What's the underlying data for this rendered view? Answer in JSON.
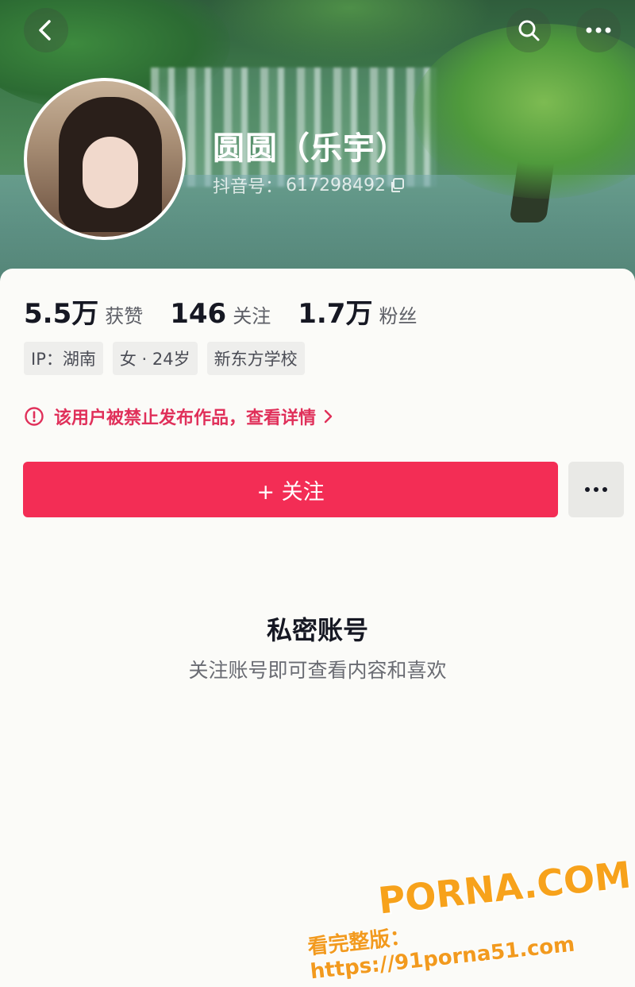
{
  "header": {
    "back_icon": "chevron-left-icon",
    "search_icon": "search-icon",
    "more_icon": "more-horizontal-icon"
  },
  "profile": {
    "name": "圆圆（乐宇）",
    "id_label": "抖音号：",
    "id_value": "617298492",
    "copy_icon": "copy-icon"
  },
  "stats": [
    {
      "value": "5.5万",
      "label": "获赞"
    },
    {
      "value": "146",
      "label": "关注"
    },
    {
      "value": "1.7万",
      "label": "粉丝"
    }
  ],
  "tags": [
    "IP：湖南",
    "女 · 24岁",
    "新东方学校"
  ],
  "notice": {
    "text": "该用户被禁止发布作品，查看详情",
    "color": "#e0305a"
  },
  "actions": {
    "follow_label": "+ 关注",
    "follow_color": "#f32d55"
  },
  "private": {
    "title": "私密账号",
    "subtitle": "关注账号即可查看内容和喜欢"
  },
  "watermark": {
    "line1": "PORNA.COM",
    "line2": "看完整版：https://91porna51.com"
  }
}
